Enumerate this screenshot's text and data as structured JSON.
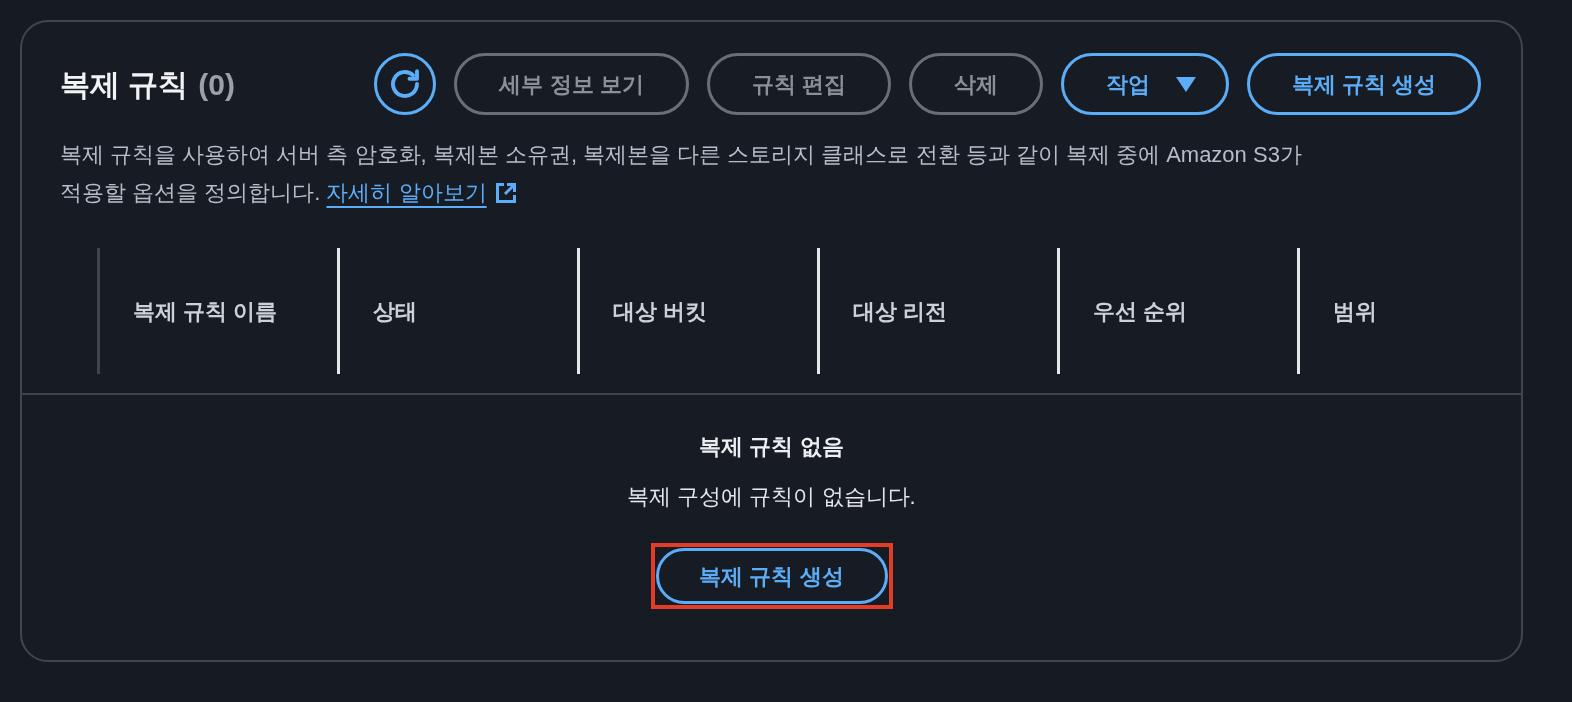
{
  "panel": {
    "title": "복제 규칙",
    "count": "(0)"
  },
  "toolbar": [
    {
      "kind": "refresh",
      "disabled": false
    },
    {
      "kind": "button",
      "label": "세부 정보 보기",
      "disabled": true
    },
    {
      "kind": "button",
      "label": "규칙 편집",
      "disabled": true
    },
    {
      "kind": "button",
      "label": "삭제",
      "disabled": true
    },
    {
      "kind": "dropdown",
      "label": "작업",
      "disabled": false
    },
    {
      "kind": "button",
      "label": "복제 규칙 생성",
      "disabled": false
    }
  ],
  "description": {
    "text": "복제 규칙을 사용하여 서버 측 암호화, 복제본 소유권, 복제본을 다른 스토리지 클래스로 전환 등과 같이 복제 중에 Amazon S3가 적용할 옵션을 정의합니다.",
    "link": "자세히 알아보기"
  },
  "table": {
    "columns": [
      "복제 규칙 이름",
      "상태",
      "대상 버킷",
      "대상 리전",
      "우선 순위",
      "범위"
    ]
  },
  "empty_state": {
    "title": "복제 규칙 없음",
    "message": "복제 구성에 규칙이 없습니다.",
    "button": {
      "label": "복제 규칙 생성",
      "highlighted": true
    }
  }
}
